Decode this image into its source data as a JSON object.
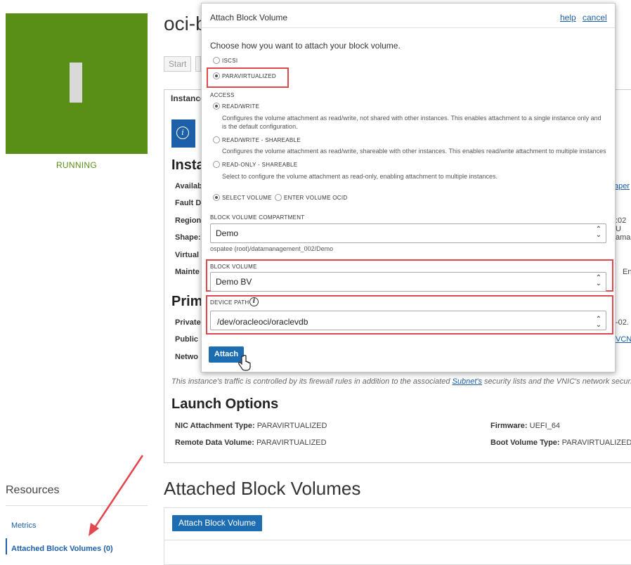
{
  "page": {
    "title_partial": "oci-b",
    "status": "RUNNING",
    "start_button": "Start",
    "tab_label": "Instance",
    "section_instance": "Insta",
    "section_primary": "Prim",
    "left_labels": [
      "Availab",
      "Fault D",
      "Region",
      "Shape:",
      "Virtual",
      "Mainte"
    ],
    "primary_labels": [
      "Private",
      "Public",
      "Netwo"
    ],
    "right_fragments": [
      "aper",
      ":02 U",
      "amar",
      "En",
      "-02.",
      "VCN"
    ],
    "right_colon": ":",
    "note_prefix": "This instance's traffic is controlled by its firewall rules in addition to the associated ",
    "note_link": "Subnet's",
    "note_suffix": " security lists and the VNIC's network security",
    "launch_title": "Launch Options",
    "launch": [
      {
        "label": "NIC Attachment Type:",
        "value": "PARAVIRTUALIZED"
      },
      {
        "label": "Remote Data Volume:",
        "value": "PARAVIRTUALIZED"
      },
      {
        "label": "Firmware:",
        "value": "UEFI_64"
      },
      {
        "label": "Boot Volume Type:",
        "value": "PARAVIRTUALIZED"
      }
    ],
    "resources_title": "Resources",
    "resources_items": [
      "Metrics",
      "Attached Block Volumes (0)"
    ],
    "attached_title": "Attached Block Volumes",
    "attach_bv_button": "Attach Block Volume"
  },
  "modal": {
    "title": "Attach Block Volume",
    "help": "help",
    "cancel": "cancel",
    "prompt": "Choose how you want to attach your block volume.",
    "attach_types": [
      {
        "label": "ISCSI",
        "selected": false
      },
      {
        "label": "PARAVIRTUALIZED",
        "selected": true
      }
    ],
    "access_label": "ACCESS",
    "access_options": [
      {
        "label": "READ/WRITE",
        "selected": true,
        "desc": "Configures the volume attachment as read/write, not shared with other instances. This enables attachment to a single instance only and is the default configuration."
      },
      {
        "label": "READ/WRITE - SHAREABLE",
        "selected": false,
        "desc": "Configures the volume attachment as read/write, shareable with other instances. This enables read/write attachment to multiple instances"
      },
      {
        "label": "READ-ONLY - SHAREABLE",
        "selected": false,
        "desc": "Select to configure the volume attachment as read-only, enabling attachment to multiple instances."
      }
    ],
    "volume_mode": [
      {
        "label": "SELECT VOLUME",
        "selected": true
      },
      {
        "label": "ENTER VOLUME OCID",
        "selected": false
      }
    ],
    "compartment_label": "BLOCK VOLUME COMPARTMENT",
    "compartment_value": "Demo",
    "compartment_path": "ospatee (root)/datamanagement_002/Demo",
    "block_volume_label": "BLOCK VOLUME",
    "block_volume_value": "Demo BV",
    "device_path_label": "DEVICE PATH",
    "device_path_value": "/dev/oracleoci/oraclevdb",
    "attach_button": "Attach"
  },
  "colors": {
    "instance_green": "#5a8f17",
    "accent_blue": "#1d6db3",
    "highlight_red": "#e0484d"
  }
}
